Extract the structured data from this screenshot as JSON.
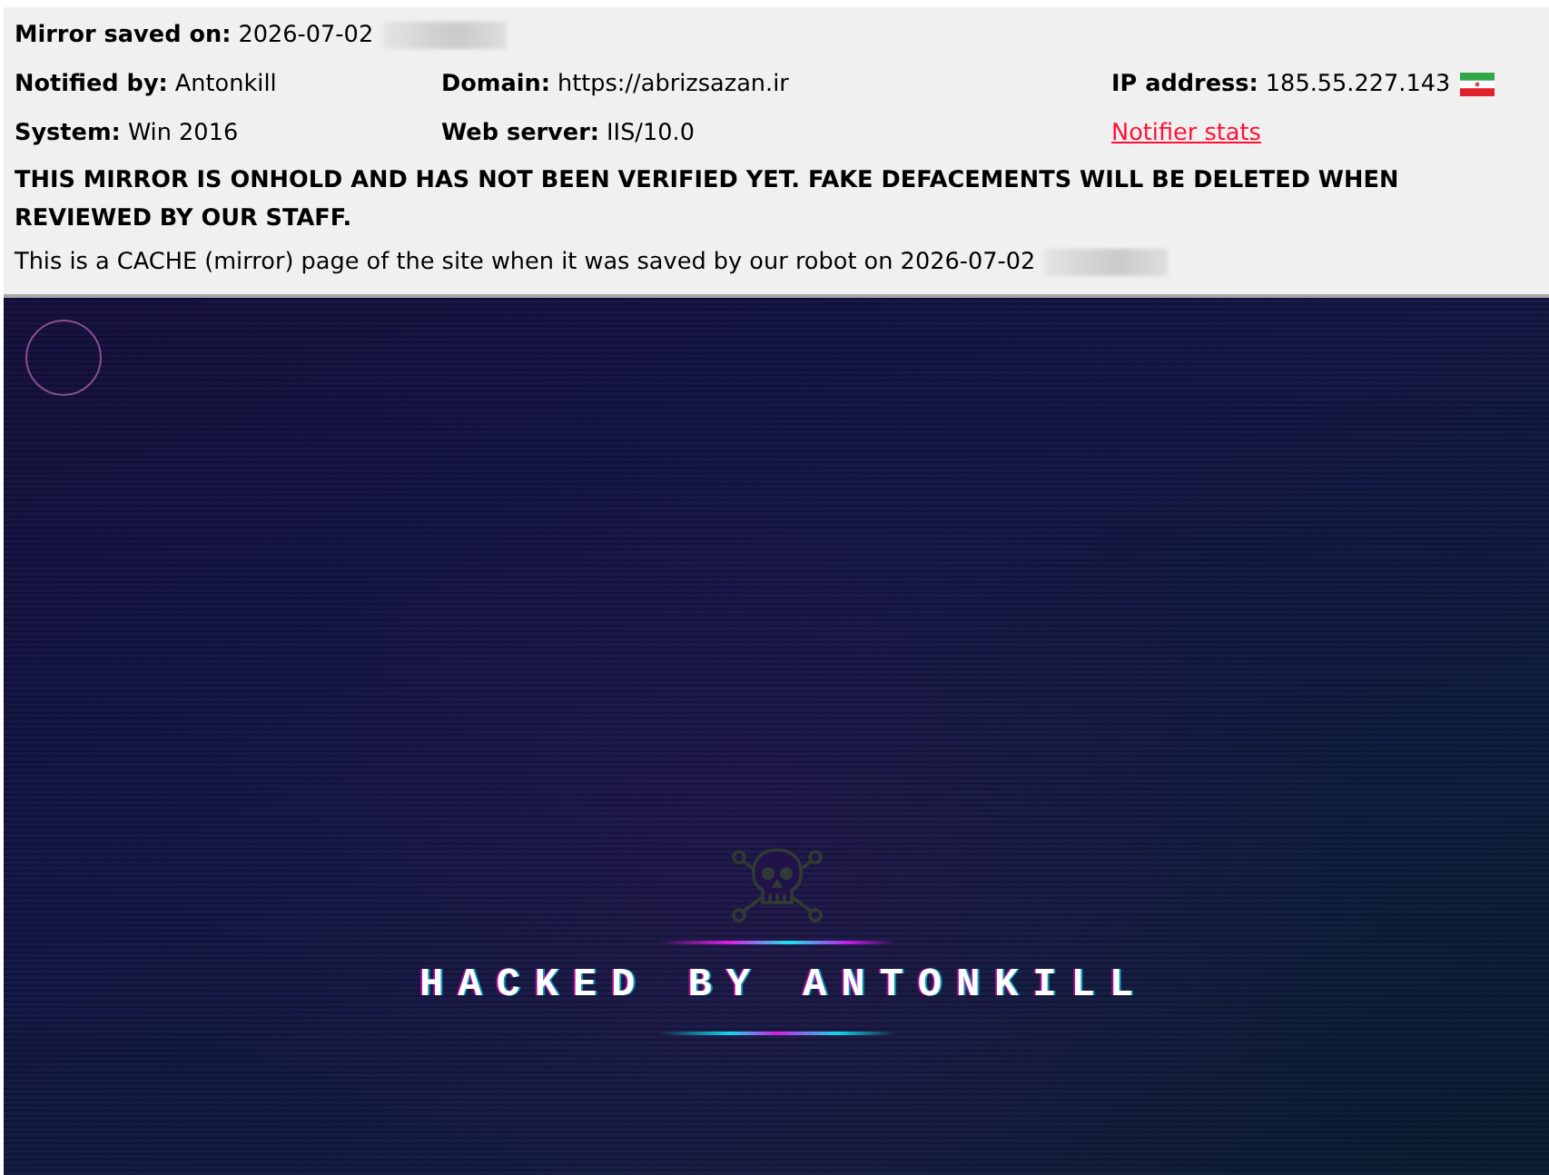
{
  "header": {
    "saved": {
      "label": "Mirror saved on:",
      "value": "2026-07-02",
      "time_redacted": true
    },
    "details": [
      [
        {
          "kind": "field",
          "label": "Notified by:",
          "value": "Antonkill"
        },
        {
          "kind": "field",
          "label": "Domain:",
          "value": "https://abrizsazan.ir"
        },
        {
          "kind": "flagged",
          "label": "IP address:",
          "value": "185.55.227.143"
        }
      ],
      [
        {
          "kind": "field",
          "label": "System:",
          "value": "Win 2016"
        },
        {
          "kind": "field",
          "label": "Web server:",
          "value": "IIS/10.0"
        },
        {
          "kind": "link",
          "text": "Notifier stats"
        }
      ]
    ],
    "warning": "THIS MIRROR IS ONHOLD AND HAS NOT BEEN VERIFIED YET. FAKE DEFACEMENTS WILL BE DELETED WHEN REVIEWED BY OUR STAFF.",
    "cache_note": {
      "text": "This is a CACHE (mirror) page of the site when it was saved by our robot on 2026-07-02",
      "time_redacted": true
    }
  },
  "mirror": {
    "title": "HACKED BY ANTONKILL"
  }
}
